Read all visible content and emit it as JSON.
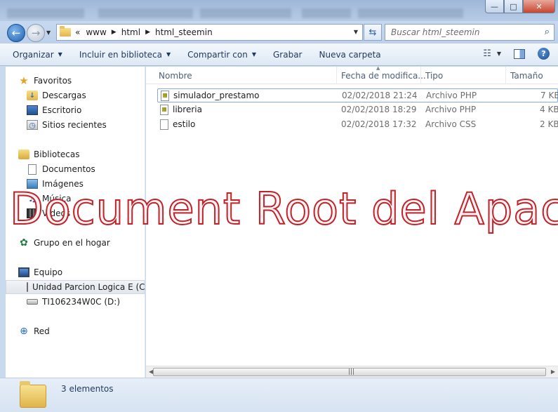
{
  "window": {
    "minimize_glyph": "—",
    "maximize_glyph": "□",
    "close_glyph": "✕"
  },
  "address": {
    "overflow": "«",
    "crumbs": [
      "www",
      "html",
      "html_steemin"
    ],
    "search_placeholder": "Buscar html_steemin"
  },
  "toolbar": {
    "organize": "Organizar",
    "include_library": "Incluir en biblioteca",
    "share_with": "Compartir con",
    "burn": "Grabar",
    "new_folder": "Nueva carpeta"
  },
  "sidebar": {
    "favorites": "Favoritos",
    "downloads": "Descargas",
    "desktop": "Escritorio",
    "recent_places": "Sitios recientes",
    "libraries": "Bibliotecas",
    "documents": "Documentos",
    "images": "Imágenes",
    "music": "Música",
    "videos": "Vídeos",
    "homegroup": "Grupo en el hogar",
    "computer": "Equipo",
    "drive_e": "Unidad Parcion Logica E (C:",
    "drive_d": "TI106234W0C (D:)",
    "network": "Red"
  },
  "columns": {
    "name": "Nombre",
    "date": "Fecha de modifica...",
    "type": "Tipo",
    "size": "Tamaño"
  },
  "files": [
    {
      "name": "simulador_prestamo",
      "date": "02/02/2018 21:24",
      "type": "Archivo PHP",
      "size": "7 KB"
    },
    {
      "name": "libreria",
      "date": "02/02/2018 18:29",
      "type": "Archivo PHP",
      "size": "4 KB"
    },
    {
      "name": "estilo",
      "date": "02/02/2018 17:32",
      "type": "Archivo CSS",
      "size": "2 KB"
    }
  ],
  "status": {
    "count": "3 elementos"
  },
  "overlay": {
    "text": "Document Root del Apache"
  },
  "colors": {
    "accent": "#1e395b",
    "overlay_stroke": "#c2232b",
    "selection_border": "#84acdd"
  }
}
